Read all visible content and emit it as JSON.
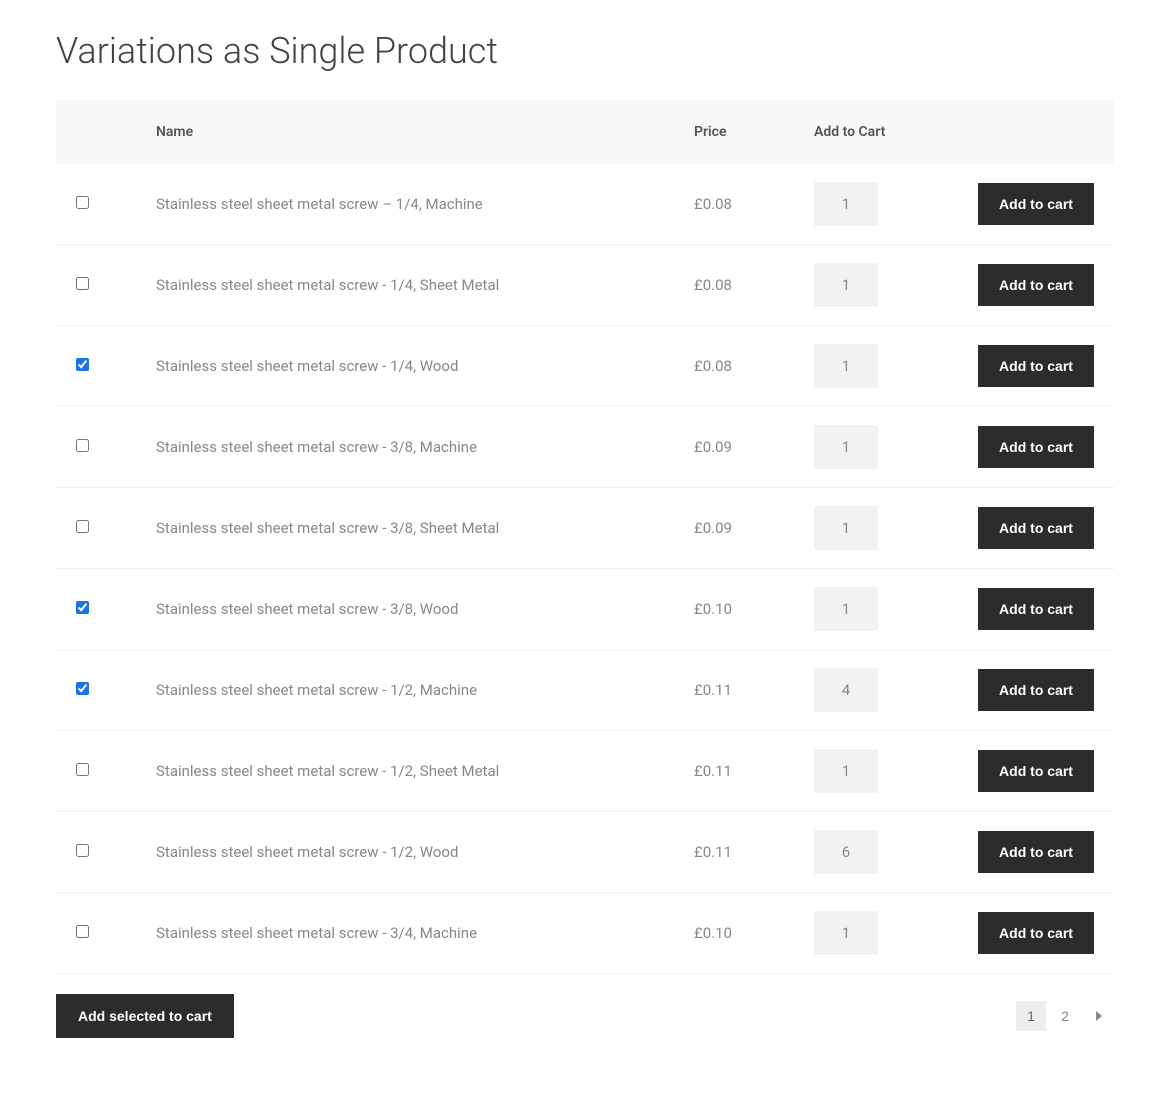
{
  "page": {
    "title": "Variations as Single Product"
  },
  "table": {
    "headers": {
      "name": "Name",
      "price": "Price",
      "add_to_cart": "Add to Cart"
    },
    "add_button_label": "Add to cart",
    "rows": [
      {
        "checked": false,
        "name": "Stainless steel sheet metal screw – 1/4, Machine",
        "price": "£0.08",
        "qty": "1"
      },
      {
        "checked": false,
        "name": "Stainless steel sheet metal screw - 1/4, Sheet Metal",
        "price": "£0.08",
        "qty": "1"
      },
      {
        "checked": true,
        "name": "Stainless steel sheet metal screw - 1/4, Wood",
        "price": "£0.08",
        "qty": "1"
      },
      {
        "checked": false,
        "name": "Stainless steel sheet metal screw - 3/8, Machine",
        "price": "£0.09",
        "qty": "1"
      },
      {
        "checked": false,
        "name": "Stainless steel sheet metal screw - 3/8, Sheet Metal",
        "price": "£0.09",
        "qty": "1"
      },
      {
        "checked": true,
        "name": "Stainless steel sheet metal screw - 3/8, Wood",
        "price": "£0.10",
        "qty": "1"
      },
      {
        "checked": true,
        "name": "Stainless steel sheet metal screw - 1/2, Machine",
        "price": "£0.11",
        "qty": "4"
      },
      {
        "checked": false,
        "name": "Stainless steel sheet metal screw - 1/2, Sheet Metal",
        "price": "£0.11",
        "qty": "1"
      },
      {
        "checked": false,
        "name": "Stainless steel sheet metal screw - 1/2, Wood",
        "price": "£0.11",
        "qty": "6"
      },
      {
        "checked": false,
        "name": "Stainless steel sheet metal screw - 3/4, Machine",
        "price": "£0.10",
        "qty": "1"
      }
    ]
  },
  "footer": {
    "add_selected_label": "Add selected to cart",
    "pagination": {
      "pages": [
        "1",
        "2"
      ],
      "current": 0
    }
  }
}
